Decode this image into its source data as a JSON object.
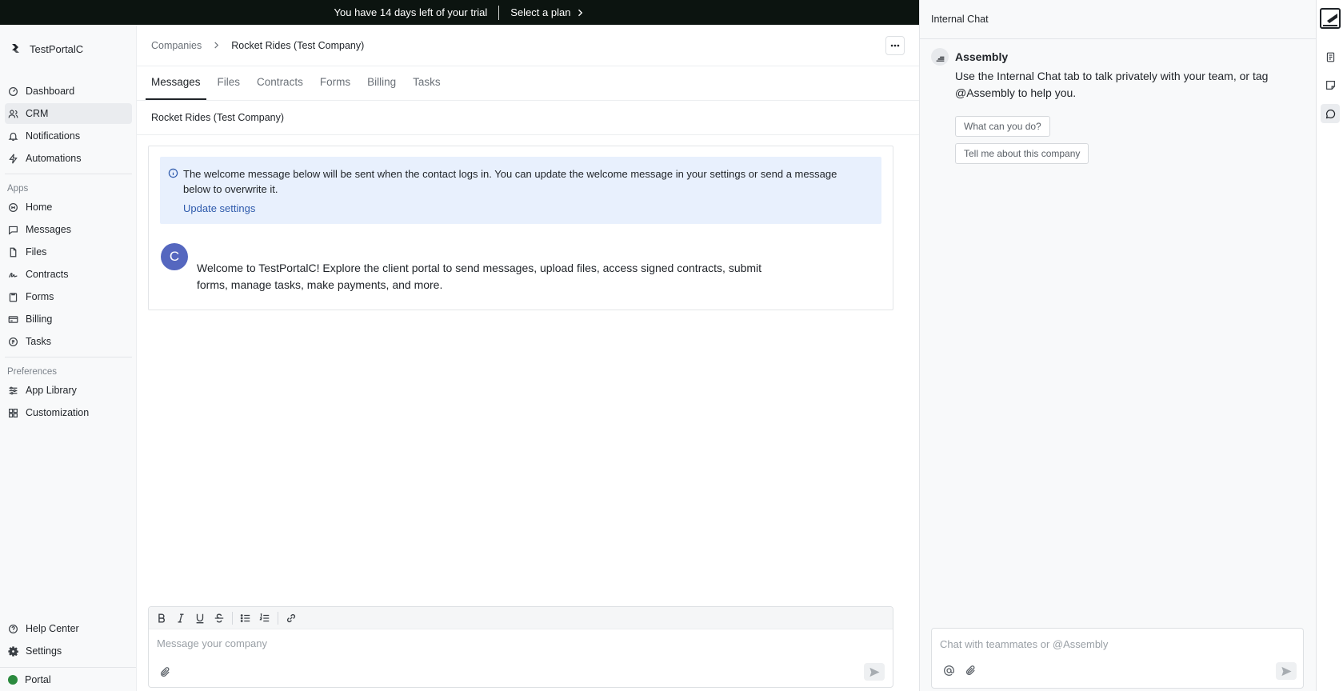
{
  "trial_banner": {
    "message": "You have 14 days left of your trial",
    "plan_label": "Select a plan"
  },
  "sidebar": {
    "workspace_name": "TestPortalC",
    "main_nav": [
      {
        "label": "Dashboard",
        "icon": "dashboard-icon"
      },
      {
        "label": "CRM",
        "icon": "users-icon",
        "active": true
      },
      {
        "label": "Notifications",
        "icon": "bell-icon"
      },
      {
        "label": "Automations",
        "icon": "bolt-icon"
      }
    ],
    "apps_label": "Apps",
    "apps_nav": [
      {
        "label": "Home",
        "icon": "home-icon"
      },
      {
        "label": "Messages",
        "icon": "chat-icon"
      },
      {
        "label": "Files",
        "icon": "file-icon"
      },
      {
        "label": "Contracts",
        "icon": "signature-icon"
      },
      {
        "label": "Forms",
        "icon": "clipboard-icon"
      },
      {
        "label": "Billing",
        "icon": "credit-card-icon"
      },
      {
        "label": "Tasks",
        "icon": "tasks-icon"
      }
    ],
    "preferences_label": "Preferences",
    "preferences_nav": [
      {
        "label": "App Library",
        "icon": "sliders-icon"
      },
      {
        "label": "Customization",
        "icon": "grid-icon"
      }
    ],
    "footer_nav": [
      {
        "label": "Help Center",
        "icon": "help-icon"
      },
      {
        "label": "Settings",
        "icon": "gear-icon"
      }
    ],
    "portal_label": "Portal",
    "portal_status_color": "#2b8a3e"
  },
  "main": {
    "breadcrumb": {
      "parent": "Companies",
      "current": "Rocket Rides (Test Company)"
    },
    "tabs": [
      {
        "label": "Messages",
        "active": true
      },
      {
        "label": "Files"
      },
      {
        "label": "Contracts"
      },
      {
        "label": "Forms"
      },
      {
        "label": "Billing"
      },
      {
        "label": "Tasks"
      }
    ],
    "sub_title": "Rocket Rides (Test Company)",
    "info_banner": {
      "text": "The welcome message below will be sent when the contact logs in. You can update the welcome message in your settings or send a message below to overwrite it.",
      "link": "Update settings"
    },
    "welcome": {
      "avatar_letter": "C",
      "avatar_color": "#5567bf",
      "text": "Welcome to TestPortalC! Explore the client portal to send messages, upload files, access signed contracts, submit forms, manage tasks, make payments, and more."
    },
    "composer": {
      "placeholder": "Message your company"
    }
  },
  "chat": {
    "title": "Internal Chat",
    "assistant_name": "Assembly",
    "assistant_message": "Use the Internal Chat tab to talk privately with your team, or tag @Assembly to help you.",
    "suggestions": [
      "What can you do?",
      "Tell me about this company"
    ],
    "input_placeholder": "Chat with teammates or @Assembly"
  }
}
